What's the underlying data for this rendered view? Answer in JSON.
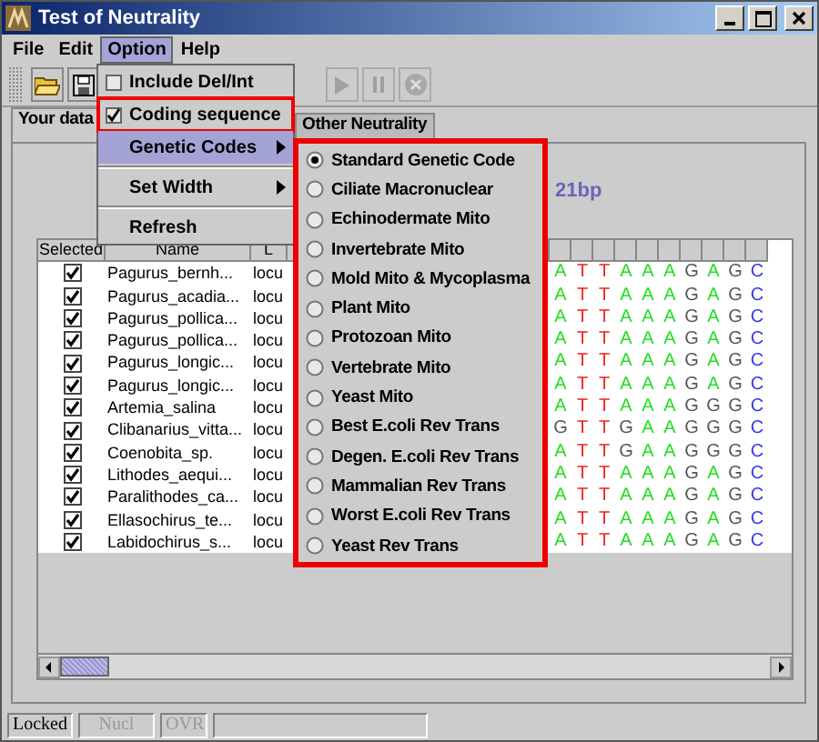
{
  "window": {
    "title": "Test of Neutrality"
  },
  "menubar": [
    {
      "label": "File",
      "selected": false
    },
    {
      "label": "Edit",
      "selected": false
    },
    {
      "label": "Option",
      "selected": true
    },
    {
      "label": "Help",
      "selected": false
    }
  ],
  "toolbar": [
    {
      "kind": "open",
      "disabled": false
    },
    {
      "kind": "save",
      "disabled": false
    },
    {
      "kind": "play",
      "disabled": true
    },
    {
      "kind": "pause",
      "disabled": true
    },
    {
      "kind": "stop",
      "disabled": true
    }
  ],
  "tabs": [
    {
      "label": "Your data",
      "selected": true
    },
    {
      "label": "Other Neutrality",
      "selected": false
    }
  ],
  "length_label": "21bp",
  "table": {
    "columns": [
      "Selected",
      "Name",
      "L"
    ],
    "rows": [
      {
        "checked": true,
        "name": "Pagurus_bernh...",
        "locus": "locu",
        "bases": [
          {
            "b": "A",
            "color": "#22dd22"
          },
          {
            "b": "T",
            "color": "#ee2222"
          },
          {
            "b": "T",
            "color": "#ee2222"
          },
          {
            "b": "A",
            "color": "#22dd22"
          },
          {
            "b": "A",
            "color": "#22dd22"
          },
          {
            "b": "A",
            "color": "#22dd22"
          },
          {
            "b": "G",
            "color": "#555555"
          },
          {
            "b": "A",
            "color": "#22dd22"
          },
          {
            "b": "G",
            "color": "#555555"
          },
          {
            "b": "C",
            "color": "#3333ee"
          }
        ]
      },
      {
        "checked": true,
        "name": "Pagurus_acadia...",
        "locus": "locu",
        "bases": [
          {
            "b": "A",
            "color": "#22dd22"
          },
          {
            "b": "T",
            "color": "#ee2222"
          },
          {
            "b": "T",
            "color": "#ee2222"
          },
          {
            "b": "A",
            "color": "#22dd22"
          },
          {
            "b": "A",
            "color": "#22dd22"
          },
          {
            "b": "A",
            "color": "#22dd22"
          },
          {
            "b": "G",
            "color": "#555555"
          },
          {
            "b": "A",
            "color": "#22dd22"
          },
          {
            "b": "G",
            "color": "#555555"
          },
          {
            "b": "C",
            "color": "#3333ee"
          }
        ]
      },
      {
        "checked": true,
        "name": "Pagurus_pollica...",
        "locus": "locu",
        "bases": [
          {
            "b": "A",
            "color": "#22dd22"
          },
          {
            "b": "T",
            "color": "#ee2222"
          },
          {
            "b": "T",
            "color": "#ee2222"
          },
          {
            "b": "A",
            "color": "#22dd22"
          },
          {
            "b": "A",
            "color": "#22dd22"
          },
          {
            "b": "A",
            "color": "#22dd22"
          },
          {
            "b": "G",
            "color": "#555555"
          },
          {
            "b": "A",
            "color": "#22dd22"
          },
          {
            "b": "G",
            "color": "#555555"
          },
          {
            "b": "C",
            "color": "#3333ee"
          }
        ]
      },
      {
        "checked": true,
        "name": "Pagurus_pollica...",
        "locus": "locu",
        "bases": [
          {
            "b": "A",
            "color": "#22dd22"
          },
          {
            "b": "T",
            "color": "#ee2222"
          },
          {
            "b": "T",
            "color": "#ee2222"
          },
          {
            "b": "A",
            "color": "#22dd22"
          },
          {
            "b": "A",
            "color": "#22dd22"
          },
          {
            "b": "A",
            "color": "#22dd22"
          },
          {
            "b": "G",
            "color": "#555555"
          },
          {
            "b": "A",
            "color": "#22dd22"
          },
          {
            "b": "G",
            "color": "#555555"
          },
          {
            "b": "C",
            "color": "#3333ee"
          }
        ]
      },
      {
        "checked": true,
        "name": "Pagurus_longic...",
        "locus": "locu",
        "bases": [
          {
            "b": "A",
            "color": "#22dd22"
          },
          {
            "b": "T",
            "color": "#ee2222"
          },
          {
            "b": "T",
            "color": "#ee2222"
          },
          {
            "b": "A",
            "color": "#22dd22"
          },
          {
            "b": "A",
            "color": "#22dd22"
          },
          {
            "b": "A",
            "color": "#22dd22"
          },
          {
            "b": "G",
            "color": "#555555"
          },
          {
            "b": "A",
            "color": "#22dd22"
          },
          {
            "b": "G",
            "color": "#555555"
          },
          {
            "b": "C",
            "color": "#3333ee"
          }
        ]
      },
      {
        "checked": true,
        "name": "Pagurus_longic...",
        "locus": "locu",
        "bases": [
          {
            "b": "A",
            "color": "#22dd22"
          },
          {
            "b": "T",
            "color": "#ee2222"
          },
          {
            "b": "T",
            "color": "#ee2222"
          },
          {
            "b": "A",
            "color": "#22dd22"
          },
          {
            "b": "A",
            "color": "#22dd22"
          },
          {
            "b": "A",
            "color": "#22dd22"
          },
          {
            "b": "G",
            "color": "#555555"
          },
          {
            "b": "A",
            "color": "#22dd22"
          },
          {
            "b": "G",
            "color": "#555555"
          },
          {
            "b": "C",
            "color": "#3333ee"
          }
        ]
      },
      {
        "checked": true,
        "name": "Artemia_salina",
        "locus": "locu",
        "bases": [
          {
            "b": "A",
            "color": "#22dd22"
          },
          {
            "b": "T",
            "color": "#ee2222"
          },
          {
            "b": "T",
            "color": "#ee2222"
          },
          {
            "b": "A",
            "color": "#22dd22"
          },
          {
            "b": "A",
            "color": "#22dd22"
          },
          {
            "b": "A",
            "color": "#22dd22"
          },
          {
            "b": "G",
            "color": "#555555"
          },
          {
            "b": "G",
            "color": "#555555"
          },
          {
            "b": "G",
            "color": "#555555"
          },
          {
            "b": "C",
            "color": "#3333ee"
          }
        ]
      },
      {
        "checked": true,
        "name": "Clibanarius_vitta...",
        "locus": "locu",
        "bases": [
          {
            "b": "G",
            "color": "#555555"
          },
          {
            "b": "T",
            "color": "#ee2222"
          },
          {
            "b": "T",
            "color": "#ee2222"
          },
          {
            "b": "G",
            "color": "#555555"
          },
          {
            "b": "A",
            "color": "#22dd22"
          },
          {
            "b": "A",
            "color": "#22dd22"
          },
          {
            "b": "G",
            "color": "#555555"
          },
          {
            "b": "G",
            "color": "#555555"
          },
          {
            "b": "G",
            "color": "#555555"
          },
          {
            "b": "C",
            "color": "#3333ee"
          }
        ]
      },
      {
        "checked": true,
        "name": "Coenobita_sp.",
        "locus": "locu",
        "bases": [
          {
            "b": "A",
            "color": "#22dd22"
          },
          {
            "b": "T",
            "color": "#ee2222"
          },
          {
            "b": "T",
            "color": "#ee2222"
          },
          {
            "b": "G",
            "color": "#555555"
          },
          {
            "b": "A",
            "color": "#22dd22"
          },
          {
            "b": "A",
            "color": "#22dd22"
          },
          {
            "b": "G",
            "color": "#555555"
          },
          {
            "b": "G",
            "color": "#555555"
          },
          {
            "b": "G",
            "color": "#555555"
          },
          {
            "b": "C",
            "color": "#3333ee"
          }
        ]
      },
      {
        "checked": true,
        "name": "Lithodes_aequi...",
        "locus": "locu",
        "bases": [
          {
            "b": "A",
            "color": "#22dd22"
          },
          {
            "b": "T",
            "color": "#ee2222"
          },
          {
            "b": "T",
            "color": "#ee2222"
          },
          {
            "b": "A",
            "color": "#22dd22"
          },
          {
            "b": "A",
            "color": "#22dd22"
          },
          {
            "b": "A",
            "color": "#22dd22"
          },
          {
            "b": "G",
            "color": "#555555"
          },
          {
            "b": "A",
            "color": "#22dd22"
          },
          {
            "b": "G",
            "color": "#555555"
          },
          {
            "b": "C",
            "color": "#3333ee"
          }
        ]
      },
      {
        "checked": true,
        "name": "Paralithodes_ca...",
        "locus": "locu",
        "bases": [
          {
            "b": "A",
            "color": "#22dd22"
          },
          {
            "b": "T",
            "color": "#ee2222"
          },
          {
            "b": "T",
            "color": "#ee2222"
          },
          {
            "b": "A",
            "color": "#22dd22"
          },
          {
            "b": "A",
            "color": "#22dd22"
          },
          {
            "b": "A",
            "color": "#22dd22"
          },
          {
            "b": "G",
            "color": "#555555"
          },
          {
            "b": "A",
            "color": "#22dd22"
          },
          {
            "b": "G",
            "color": "#555555"
          },
          {
            "b": "C",
            "color": "#3333ee"
          }
        ]
      },
      {
        "checked": true,
        "name": "Ellasochirus_te...",
        "locus": "locu",
        "bases": [
          {
            "b": "A",
            "color": "#22dd22"
          },
          {
            "b": "T",
            "color": "#ee2222"
          },
          {
            "b": "T",
            "color": "#ee2222"
          },
          {
            "b": "A",
            "color": "#22dd22"
          },
          {
            "b": "A",
            "color": "#22dd22"
          },
          {
            "b": "A",
            "color": "#22dd22"
          },
          {
            "b": "G",
            "color": "#555555"
          },
          {
            "b": "A",
            "color": "#22dd22"
          },
          {
            "b": "G",
            "color": "#555555"
          },
          {
            "b": "C",
            "color": "#3333ee"
          }
        ]
      },
      {
        "checked": true,
        "name": "Labidochirus_s...",
        "locus": "locu",
        "bases": [
          {
            "b": "A",
            "color": "#22dd22"
          },
          {
            "b": "T",
            "color": "#ee2222"
          },
          {
            "b": "T",
            "color": "#ee2222"
          },
          {
            "b": "A",
            "color": "#22dd22"
          },
          {
            "b": "A",
            "color": "#22dd22"
          },
          {
            "b": "A",
            "color": "#22dd22"
          },
          {
            "b": "G",
            "color": "#555555"
          },
          {
            "b": "A",
            "color": "#22dd22"
          },
          {
            "b": "G",
            "color": "#555555"
          },
          {
            "b": "C",
            "color": "#3333ee"
          }
        ]
      }
    ]
  },
  "option_menu": {
    "items": [
      {
        "kind": "check",
        "label": "Include Del/Int",
        "checked": false,
        "annotated": false
      },
      {
        "kind": "check",
        "label": "Coding sequence",
        "checked": true,
        "annotated": true
      },
      {
        "kind": "submenu",
        "label": "Genetic Codes",
        "selected": true
      },
      {
        "kind": "separator"
      },
      {
        "kind": "submenu",
        "label": "Set Width",
        "selected": false
      },
      {
        "kind": "separator"
      },
      {
        "kind": "plain",
        "label": "Refresh"
      }
    ]
  },
  "genetic_codes_menu": {
    "annotated": true,
    "items": [
      {
        "label": "Standard Genetic Code",
        "selected": true
      },
      {
        "label": "Ciliate Macronuclear",
        "selected": false
      },
      {
        "label": "Echinodermate Mito",
        "selected": false
      },
      {
        "label": "Invertebrate Mito",
        "selected": false
      },
      {
        "label": "Mold Mito & Mycoplasma",
        "selected": false
      },
      {
        "label": "Plant Mito",
        "selected": false
      },
      {
        "label": "Protozoan Mito",
        "selected": false
      },
      {
        "label": "Vertebrate Mito",
        "selected": false
      },
      {
        "label": "Yeast Mito",
        "selected": false
      },
      {
        "label": "Best E.coli Rev Trans",
        "selected": false
      },
      {
        "label": "Degen. E.coli Rev Trans",
        "selected": false
      },
      {
        "label": "Mammalian Rev Trans",
        "selected": false
      },
      {
        "label": "Worst E.coli Rev Trans",
        "selected": false
      },
      {
        "label": "Yeast Rev Trans",
        "selected": false
      }
    ]
  },
  "status_bar": [
    {
      "label": "Locked",
      "disabled": false
    },
    {
      "label": "Nucl",
      "disabled": true
    },
    {
      "label": "OVR",
      "disabled": true
    }
  ]
}
